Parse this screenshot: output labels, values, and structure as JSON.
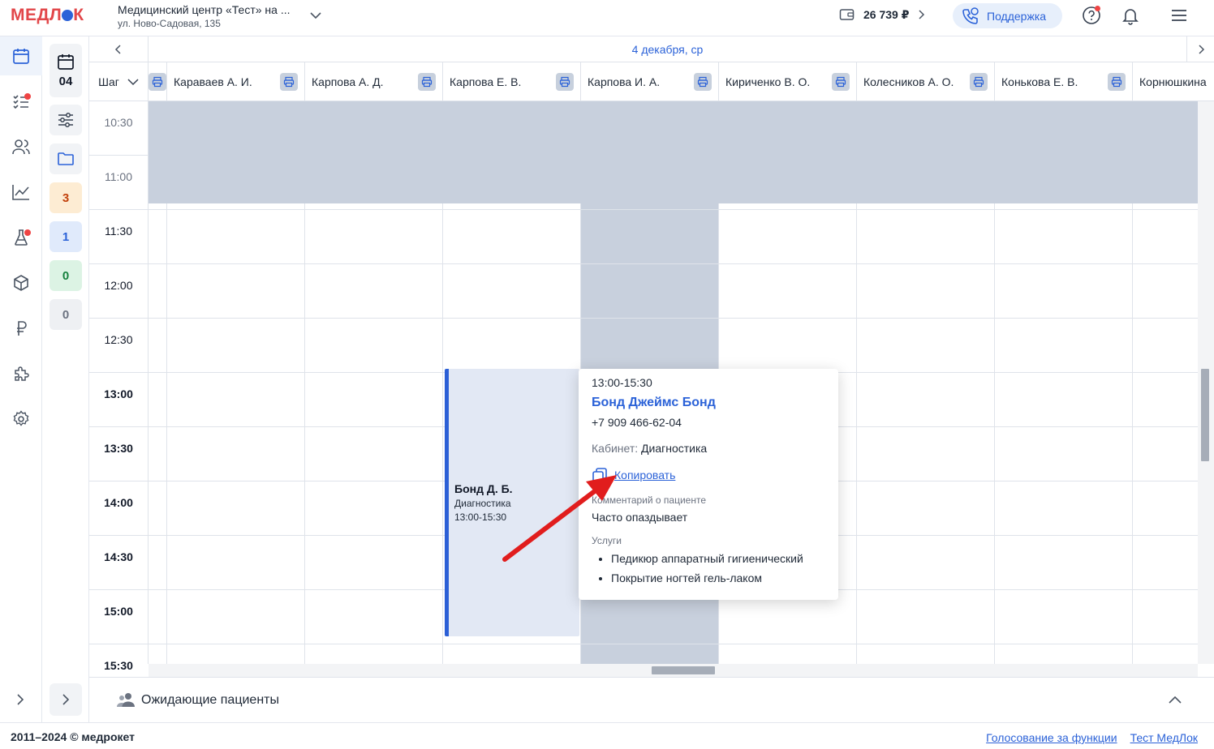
{
  "header": {
    "logo": "МЕДЛ",
    "logo_tail": "К",
    "clinic_name": "Медицинский центр «Тест» на ...",
    "clinic_address": "ул. Ново-Садовая, 135",
    "balance": "26 739 ₽",
    "support_label": "Поддержка"
  },
  "minicol": {
    "date_day": "04",
    "counters": [
      {
        "value": "3",
        "color": "#fdecd3",
        "text": "#c2410c"
      },
      {
        "value": "1",
        "color": "#e0eafb",
        "text": "#2b62d8"
      },
      {
        "value": "0",
        "color": "#dcf3e4",
        "text": "#15803d"
      },
      {
        "value": "0",
        "color": "#eef0f3",
        "text": "#6b7280"
      }
    ]
  },
  "schedule": {
    "date": "4 декабря, ср",
    "step_label": "Шаг",
    "doctors": [
      "Караваев А. И.",
      "Карпова А. Д.",
      "Карпова Е. В.",
      "Карпова И. А.",
      "Кириченко В. О.",
      "Колесников А. О.",
      "Конькова Е. В.",
      "Корнюшкина"
    ],
    "times": [
      "10:30",
      "11:00",
      "11:30",
      "12:00",
      "12:30",
      "13:00",
      "13:30",
      "14:00",
      "14:30",
      "15:00",
      "15:30"
    ]
  },
  "appointment": {
    "patient_short": "Бонд Д. Б.",
    "service": "Диагностика",
    "time": "13:00-15:30"
  },
  "popup": {
    "time": "13:00-15:30",
    "patient_name": "Бонд Джеймс Бонд",
    "phone": "+7 909 466-62-04",
    "cabinet_label": "Кабинет:",
    "cabinet_value": "Диагностика",
    "copy_label": "Копировать",
    "comment_label": "Комментарий о пациенте",
    "comment": "Часто опаздывает",
    "services_label": "Услуги",
    "services": [
      "Педикюр аппаратный гигиенический",
      "Покрытие ногтей гель-лаком"
    ]
  },
  "waiting": {
    "label": "Ожидающие пациенты"
  },
  "footer": {
    "copyright": "2011–2024 © медрокет",
    "link_vote": "Голосование за функции",
    "link_test": "Тест МедЛок"
  },
  "colors": {
    "accent": "#2b62d8",
    "brand": "#e2474a",
    "closed": "#c8d0dd"
  }
}
